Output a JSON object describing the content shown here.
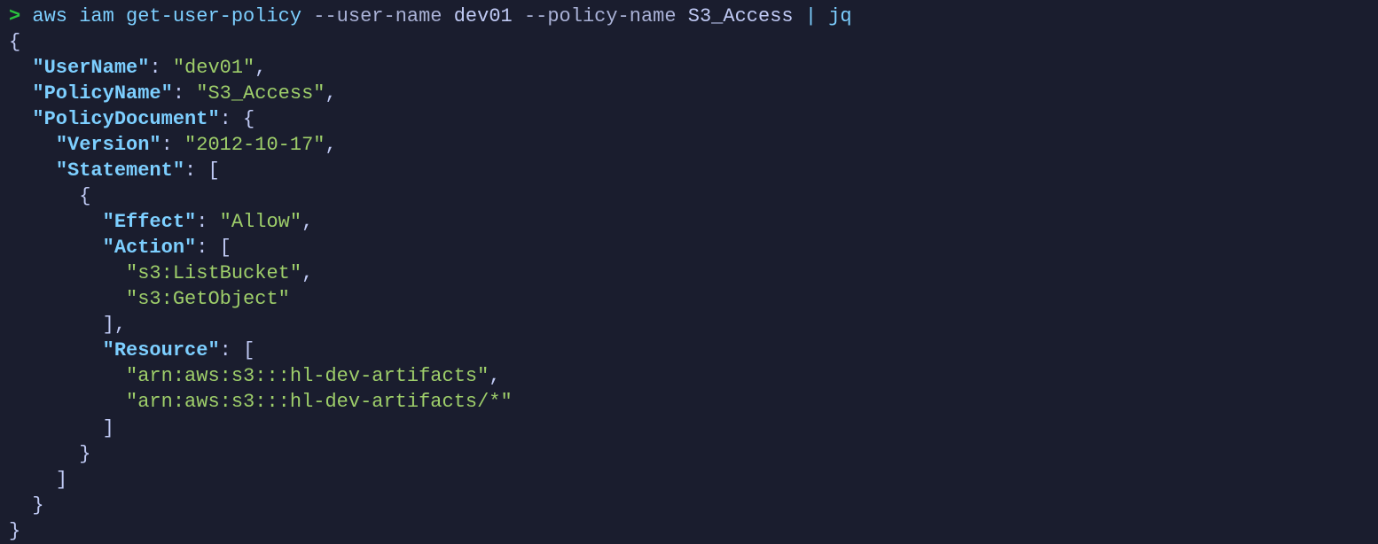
{
  "prompt": {
    "caret": ">",
    "parts": {
      "aws": "aws",
      "iam": "iam",
      "subcmd": "get-user-policy",
      "flag_user": "--user-name",
      "val_user": "dev01",
      "flag_policy": "--policy-name",
      "val_policy": "S3_Access",
      "pipe": "|",
      "jq": "jq"
    }
  },
  "json_output": {
    "keys": {
      "UserName": "\"UserName\"",
      "PolicyName": "\"PolicyName\"",
      "PolicyDocument": "\"PolicyDocument\"",
      "Version": "\"Version\"",
      "Statement": "\"Statement\"",
      "Effect": "\"Effect\"",
      "Action": "\"Action\"",
      "Resource": "\"Resource\""
    },
    "values": {
      "UserName": "\"dev01\"",
      "PolicyName": "\"S3_Access\"",
      "Version": "\"2012-10-17\"",
      "Effect": "\"Allow\"",
      "Action0": "\"s3:ListBucket\"",
      "Action1": "\"s3:GetObject\"",
      "Resource0": "\"arn:aws:s3:::hl-dev-artifacts\"",
      "Resource1": "\"arn:aws:s3:::hl-dev-artifacts/*\""
    },
    "punct": {
      "lbrace": "{",
      "rbrace": "}",
      "lbracket": "[",
      "rbracket": "]",
      "rbracket_comma": "],",
      "colon_space": ": ",
      "comma": ","
    }
  }
}
